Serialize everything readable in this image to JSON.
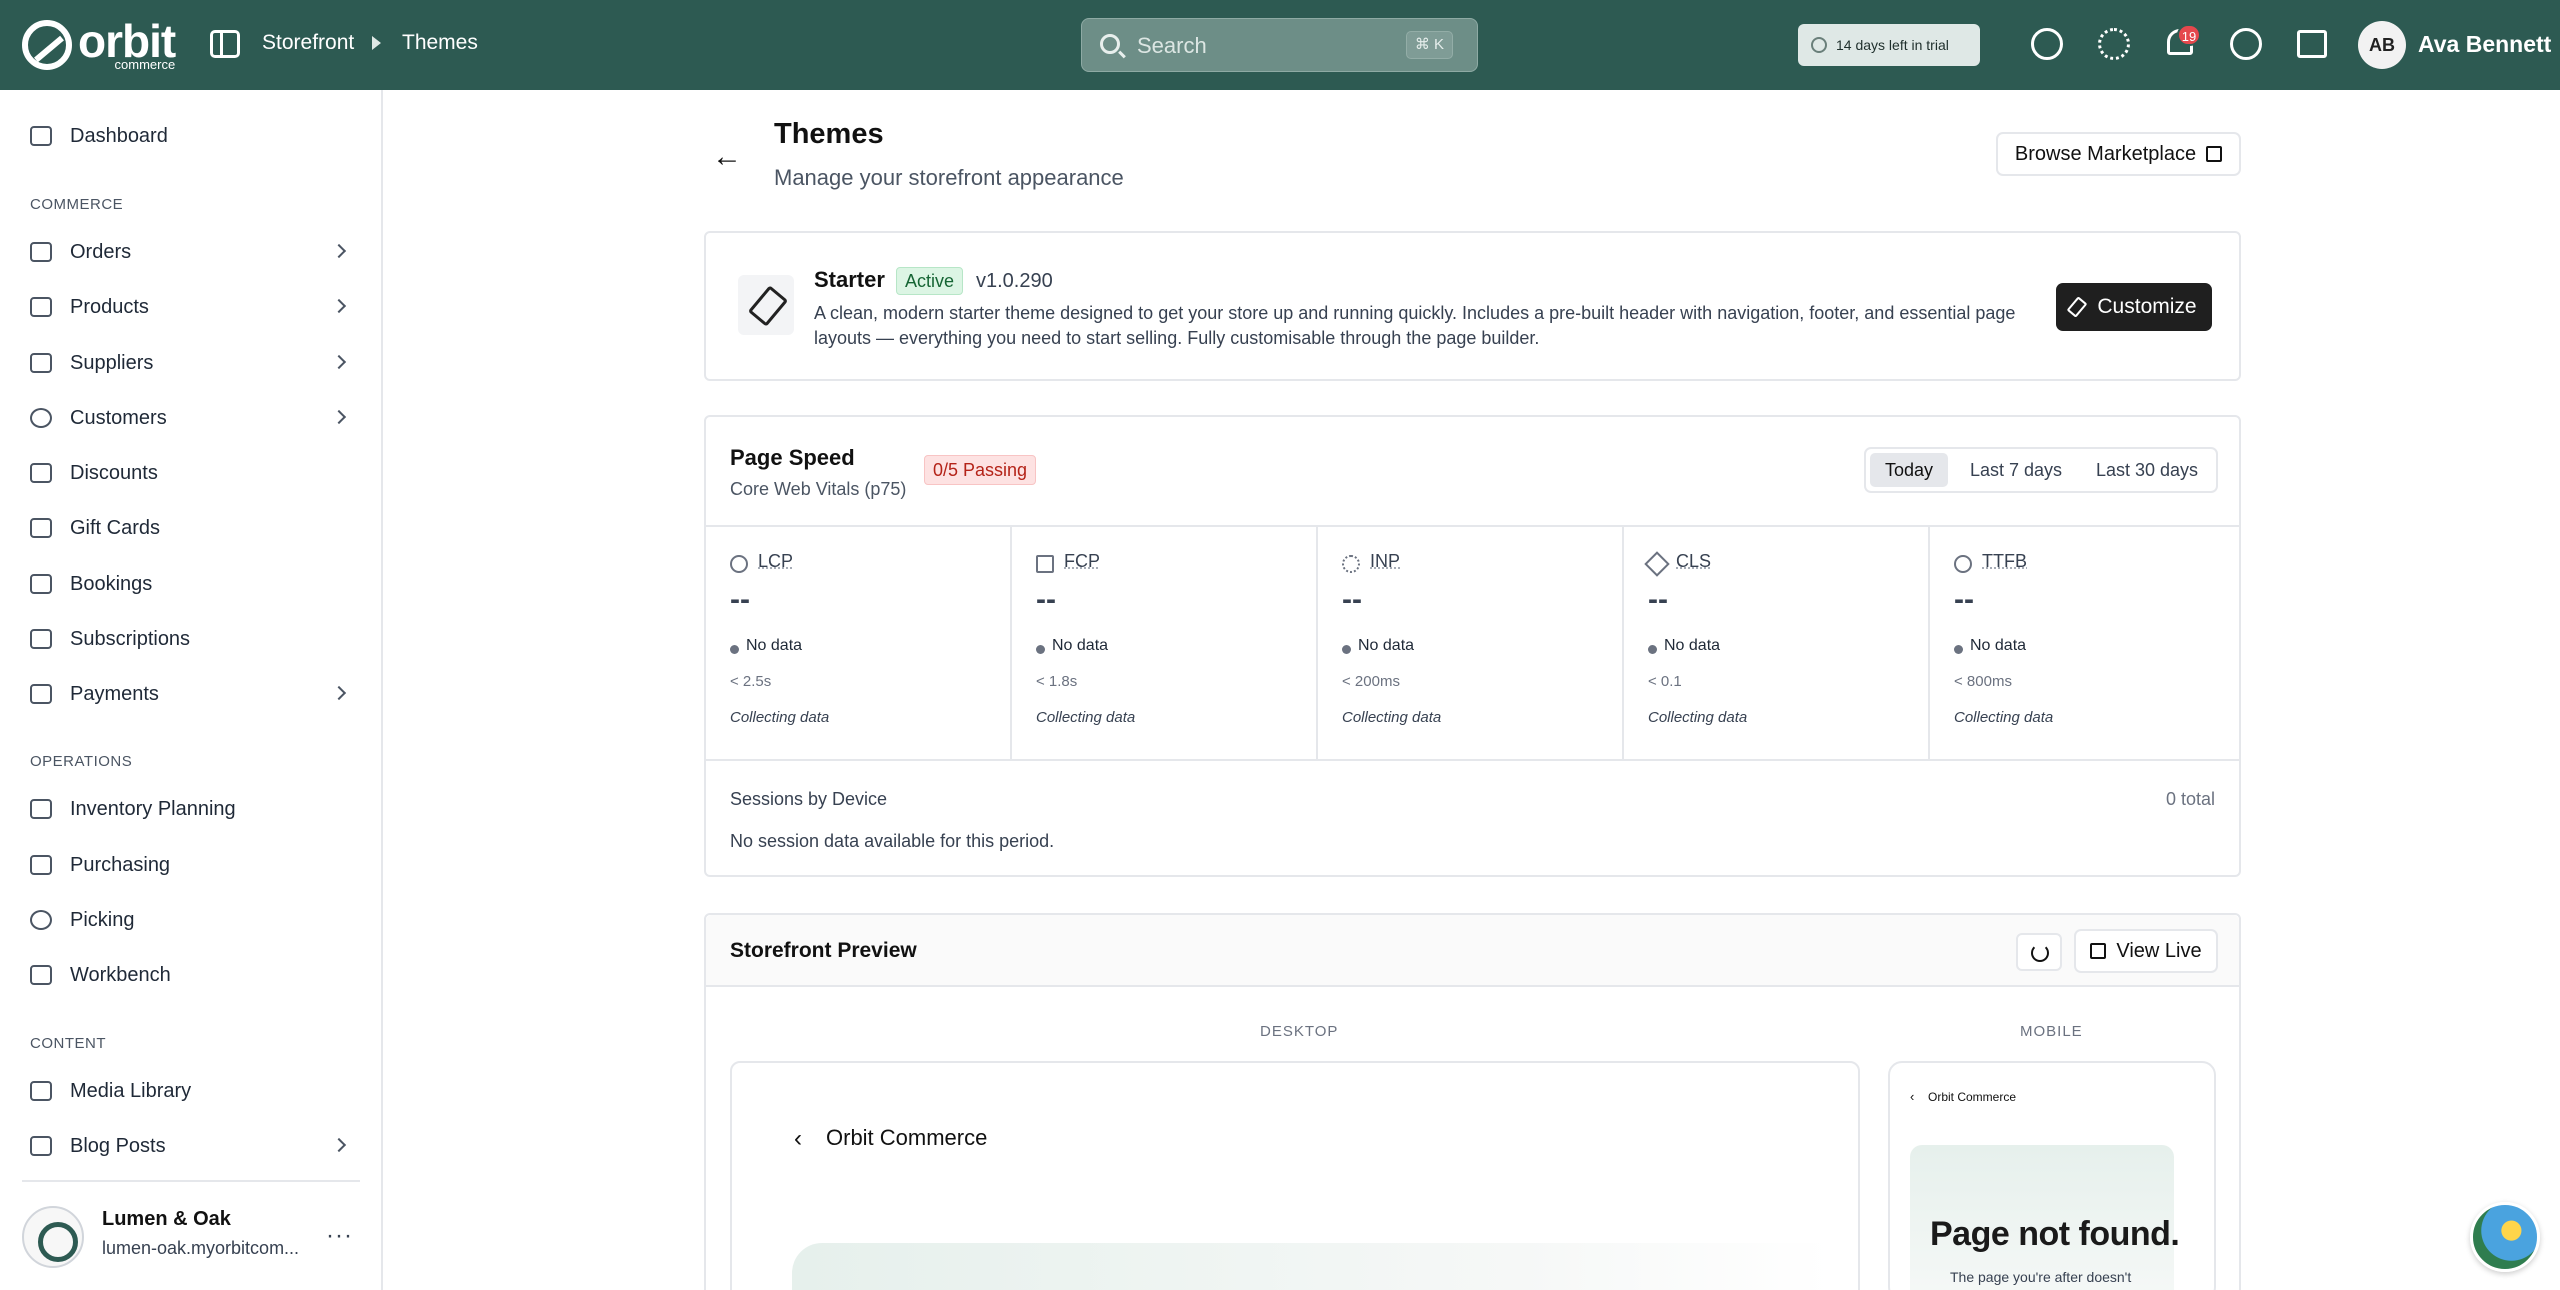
{
  "brand": {
    "name": "orbit",
    "sub": "commerce"
  },
  "breadcrumb": {
    "parent": "Storefront",
    "current": "Themes"
  },
  "search": {
    "placeholder": "Search",
    "shortcut": "⌘ K"
  },
  "trial": {
    "label": "14 days left in trial"
  },
  "notifications": {
    "count": "19"
  },
  "user": {
    "initials": "AB",
    "name": "Ava Bennett"
  },
  "icons": {
    "topbar": [
      "help-icon",
      "sun-icon",
      "bell-icon",
      "support-icon",
      "store-icon"
    ],
    "sidebar": [
      "dashboard-icon",
      "orders-icon",
      "products-icon",
      "suppliers-icon",
      "customers-icon",
      "discounts-icon",
      "gift-cards-icon",
      "bookings-icon",
      "subscriptions-icon",
      "payments-icon",
      "inventory-icon",
      "purchasing-icon",
      "picking-icon",
      "workbench-icon",
      "media-icon",
      "blog-icon"
    ]
  },
  "sidebar": {
    "dashboard": "Dashboard",
    "sections": {
      "commerce": "COMMERCE",
      "operations": "OPERATIONS",
      "content": "CONTENT"
    },
    "commerce": [
      "Orders",
      "Products",
      "Suppliers",
      "Customers",
      "Discounts",
      "Gift Cards",
      "Bookings",
      "Subscriptions",
      "Payments"
    ],
    "operations": [
      "Inventory Planning",
      "Purchasing",
      "Picking",
      "Workbench"
    ],
    "content": [
      "Media Library",
      "Blog Posts"
    ],
    "store": {
      "name": "Lumen & Oak",
      "url": "lumen-oak.myorbitcom..."
    }
  },
  "page": {
    "title": "Themes",
    "subtitle": "Manage your storefront appearance",
    "marketplace_button": "Browse Marketplace"
  },
  "theme": {
    "name": "Starter",
    "status": "Active",
    "version": "v1.0.290",
    "description": "A clean, modern starter theme designed to get your store up and running quickly. Includes a pre-built header with navigation, footer, and essential page layouts — everything you need to start selling. Fully customisable through the page builder.",
    "customize_button": "Customize"
  },
  "page_speed": {
    "title": "Page Speed",
    "subtitle": "Core Web Vitals (p75)",
    "passing": "0/5 Passing",
    "ranges": [
      "Today",
      "Last 7 days",
      "Last 30 days"
    ],
    "selected_range": "Today",
    "metrics": [
      {
        "name": "LCP",
        "value": "--",
        "status": "No data",
        "threshold": "< 2.5s",
        "note": "Collecting data"
      },
      {
        "name": "FCP",
        "value": "--",
        "status": "No data",
        "threshold": "< 1.8s",
        "note": "Collecting data"
      },
      {
        "name": "INP",
        "value": "--",
        "status": "No data",
        "threshold": "< 200ms",
        "note": "Collecting data"
      },
      {
        "name": "CLS",
        "value": "--",
        "status": "No data",
        "threshold": "< 0.1",
        "note": "Collecting data"
      },
      {
        "name": "TTFB",
        "value": "--",
        "status": "No data",
        "threshold": "< 800ms",
        "note": "Collecting data"
      }
    ],
    "sessions": {
      "title": "Sessions by Device",
      "total": "0 total",
      "empty": "No session data available for this period."
    }
  },
  "preview": {
    "title": "Storefront Preview",
    "view_live": "View Live",
    "desktop_label": "DESKTOP",
    "mobile_label": "MOBILE",
    "desktop": {
      "back": "‹",
      "brand": "Orbit Commerce"
    },
    "mobile": {
      "back": "‹",
      "brand": "Orbit Commerce",
      "heading": "Page not found.",
      "text": "The page you're after doesn't"
    }
  }
}
